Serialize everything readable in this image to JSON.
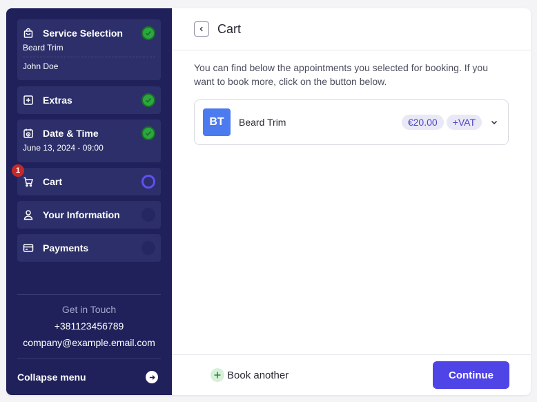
{
  "sidebar": {
    "steps": [
      {
        "title": "Service Selection",
        "icon": "bag-icon",
        "status": "done",
        "details": [
          "Beard Trim",
          "John Doe"
        ]
      },
      {
        "title": "Extras",
        "icon": "plus-square-icon",
        "status": "done"
      },
      {
        "title": "Date & Time",
        "icon": "calendar-clock-icon",
        "status": "done",
        "details": [
          "June 13, 2024 - 09:00"
        ]
      },
      {
        "title": "Cart",
        "icon": "cart-icon",
        "status": "current",
        "badge": "1"
      },
      {
        "title": "Your Information",
        "icon": "user-icon",
        "status": "pending"
      },
      {
        "title": "Payments",
        "icon": "card-icon",
        "status": "pending"
      }
    ],
    "contact": {
      "heading": "Get in Touch",
      "phone": "+381123456789",
      "email": "company@example.email.com"
    },
    "collapse_label": "Collapse menu"
  },
  "main": {
    "title": "Cart",
    "description": "You can find below the appointments you selected for booking. If you want to book more, click on the button below.",
    "item": {
      "initials": "BT",
      "name": "Beard Trim",
      "price": "€20.00",
      "vat": "+VAT"
    },
    "footer": {
      "book_another": "Book another",
      "continue": "Continue"
    }
  },
  "colors": {
    "sidebar_bg": "#20215a",
    "accent": "#4f44e6",
    "done": "#2aa83e",
    "badge": "#c52a2a",
    "avatar": "#4b7bef"
  }
}
